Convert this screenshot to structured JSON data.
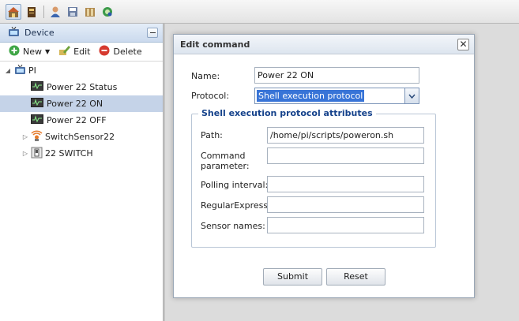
{
  "toolbar": {
    "icons": [
      "home-icon",
      "book-icon",
      "user-icon",
      "save-icon",
      "folder-icon",
      "network-icon"
    ]
  },
  "left_panel": {
    "title": "Device",
    "actions": {
      "new_label": "New",
      "edit_label": "Edit",
      "delete_label": "Delete"
    },
    "tree": [
      {
        "label": "PI",
        "icon": "device-icon",
        "expanded": true
      },
      {
        "label": "Power 22 Status",
        "icon": "command-icon"
      },
      {
        "label": "Power 22 ON",
        "icon": "command-icon",
        "selected": true
      },
      {
        "label": "Power 22 OFF",
        "icon": "command-icon"
      },
      {
        "label": "SwitchSensor22",
        "icon": "sensor-icon"
      },
      {
        "label": "22 SWITCH",
        "icon": "switch-icon"
      }
    ]
  },
  "dialog": {
    "title": "Edit command",
    "name_label": "Name:",
    "name_value": "Power 22 ON",
    "protocol_label": "Protocol:",
    "protocol_value": "Shell execution protocol",
    "fieldset_legend": "Shell execution protocol attributes",
    "path_label": "Path:",
    "path_value": "/home/pi/scripts/poweron.sh",
    "param_label_1": "Command",
    "param_label_2": "parameter:",
    "param_value": "",
    "polling_label": "Polling interval:",
    "polling_value": "",
    "regex_label": "RegularExpression:",
    "regex_value": "",
    "sensor_label": "Sensor names:",
    "sensor_value": "",
    "submit_label": "Submit",
    "reset_label": "Reset"
  },
  "colors": {
    "accent": "#15428b",
    "selection": "#3874d7",
    "tree_selected": "#c5d3e8"
  }
}
